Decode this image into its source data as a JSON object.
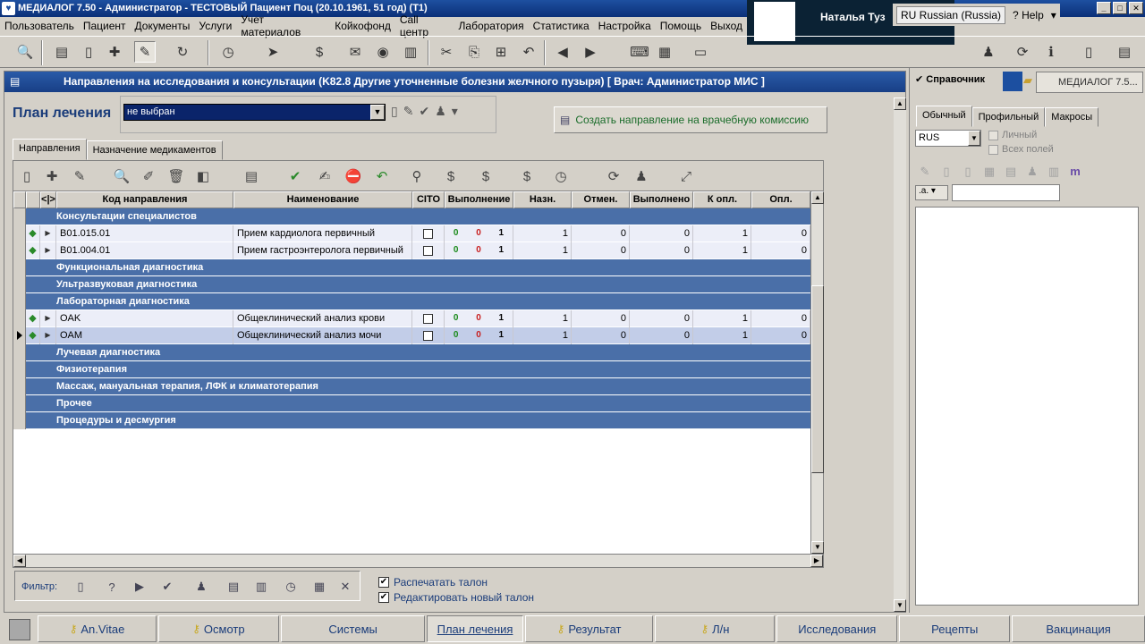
{
  "window": {
    "title": "МЕДИАЛОГ 7.50 - Администратор - ТЕСТОВЫЙ Пациент Поц (20.10.1961, 51 год) (T1)",
    "user": "Наталья Туз",
    "language": "RU Russian (Russia)",
    "help": "Help"
  },
  "menu": [
    "Пользователь",
    "Пациент",
    "Документы",
    "Услуги",
    "Учет материалов",
    "Койкофонд",
    "Call центр",
    "Лаборатория",
    "Статистика",
    "Настройка",
    "Помощь",
    "Выход"
  ],
  "document": {
    "header": "Направления на исследования и консультации (K82.8 Другие уточненные болезни желчного пузыря)  [ Врач: Администратор МИС ]",
    "plan_label": "План лечения",
    "plan_select_value": "не выбран",
    "commission_button": "Создать направление на врачебную комиссию",
    "tabs": [
      "Направления",
      "Назначение медикаментов"
    ],
    "columns": [
      "<|>",
      "Код направления",
      "Наименование",
      "CITO",
      "Выполнение",
      "Назн.",
      "Отмен.",
      "Выполнено",
      "К опл.",
      "Опл."
    ],
    "groups": [
      {
        "title": "Консультации специалистов",
        "items": [
          {
            "code": "B01.015.01",
            "name": "Прием кардиолога первичный",
            "e1": "0",
            "e2": "0",
            "e3": "1",
            "assigned": "1",
            "cancelled": "0",
            "done": "0",
            "to_pay": "1",
            "paid": "0",
            "selected": false
          },
          {
            "code": "B01.004.01",
            "name": "Прием гастроэнтеролога первичный",
            "e1": "0",
            "e2": "0",
            "e3": "1",
            "assigned": "1",
            "cancelled": "0",
            "done": "0",
            "to_pay": "1",
            "paid": "0",
            "selected": false
          }
        ]
      },
      {
        "title": "Функциональная диагностика",
        "items": []
      },
      {
        "title": "Ультразвуковая диагностика",
        "items": []
      },
      {
        "title": "Лабораторная диагностика",
        "items": [
          {
            "code": "OAK",
            "name": "Общеклинический анализ крови",
            "e1": "0",
            "e2": "0",
            "e3": "1",
            "assigned": "1",
            "cancelled": "0",
            "done": "0",
            "to_pay": "1",
            "paid": "0",
            "selected": false
          },
          {
            "code": "OAM",
            "name": "Общеклинический анализ мочи",
            "e1": "0",
            "e2": "0",
            "e3": "1",
            "assigned": "1",
            "cancelled": "0",
            "done": "0",
            "to_pay": "1",
            "paid": "0",
            "selected": true
          }
        ]
      },
      {
        "title": "Лучевая диагностика",
        "items": []
      },
      {
        "title": "Физиотерапия",
        "items": []
      },
      {
        "title": "Массаж, мануальная терапия, ЛФК и климатотерапия",
        "items": []
      },
      {
        "title": "Прочее",
        "items": []
      },
      {
        "title": "Процедуры и десмургия",
        "items": []
      }
    ],
    "filter_label": "Фильтр:",
    "print_ticket": "Распечатать талон",
    "edit_ticket": "Редактировать новый талон"
  },
  "right_panel": {
    "title": "Справочник",
    "medialog": "МЕДИАЛОГ 7.5...",
    "tabs": [
      "Обычный",
      "Профильный",
      "Макросы"
    ],
    "language": "RUS",
    "personal": "Личный",
    "all_fields": "Всех полей"
  },
  "bottom_tabs": [
    {
      "label": "An.Vitae",
      "key": true,
      "active": false
    },
    {
      "label": "Осмотр",
      "key": true,
      "active": false
    },
    {
      "label": "Системы",
      "key": false,
      "active": false
    },
    {
      "label": "План лечения",
      "key": false,
      "active": true
    },
    {
      "label": "Результат",
      "key": true,
      "active": false
    },
    {
      "label": "Л/н",
      "key": true,
      "active": false
    },
    {
      "label": "Исследования",
      "key": false,
      "active": false
    },
    {
      "label": "Рецепты",
      "key": false,
      "active": false
    },
    {
      "label": "Вакцинация",
      "key": false,
      "active": false
    }
  ]
}
